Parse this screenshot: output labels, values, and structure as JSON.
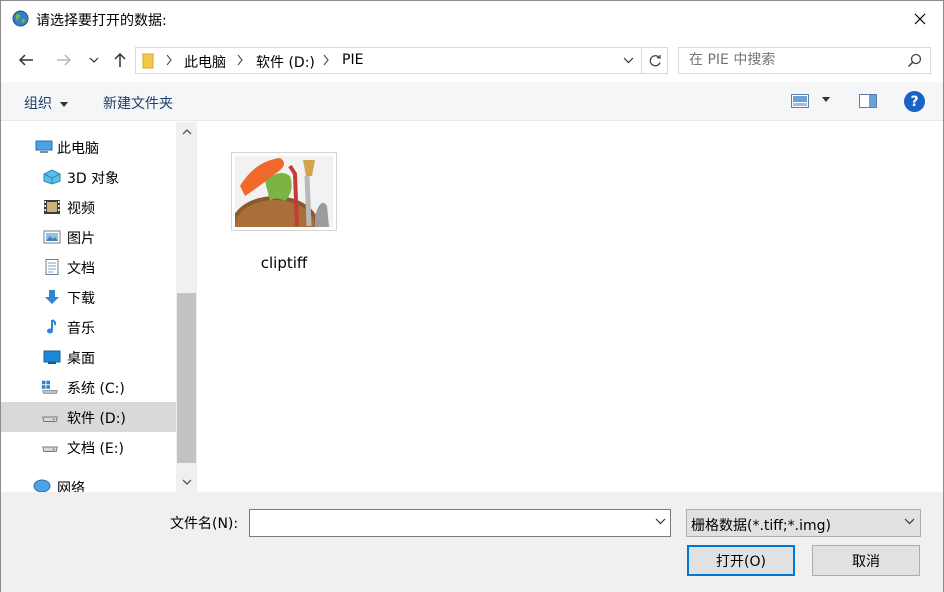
{
  "window": {
    "title": "请选择要打开的数据:"
  },
  "address": {
    "crumbs": [
      "此电脑",
      "软件 (D:)",
      "PIE"
    ]
  },
  "search": {
    "placeholder": "在 PIE 中搜索"
  },
  "toolbar": {
    "organize_label": "组织",
    "new_folder_label": "新建文件夹",
    "help_label": "?"
  },
  "navpane": {
    "items": [
      {
        "label": "此电脑",
        "icon": "computer-icon"
      },
      {
        "label": "3D 对象",
        "icon": "3d-objects-icon"
      },
      {
        "label": "视频",
        "icon": "video-icon"
      },
      {
        "label": "图片",
        "icon": "pictures-icon"
      },
      {
        "label": "文档",
        "icon": "documents-icon"
      },
      {
        "label": "下载",
        "icon": "download-icon"
      },
      {
        "label": "音乐",
        "icon": "music-icon"
      },
      {
        "label": "桌面",
        "icon": "desktop-icon"
      },
      {
        "label": "系统 (C:)",
        "icon": "windows-drive-icon"
      },
      {
        "label": "软件 (D:)",
        "icon": "drive-icon",
        "selected": true
      },
      {
        "label": "文档 (E:)",
        "icon": "drive-icon"
      },
      {
        "label": "网络",
        "icon": "network-icon"
      }
    ]
  },
  "files": [
    {
      "name": "cliptiff",
      "icon": "paint-palette-thumbnail"
    }
  ],
  "bottom": {
    "filename_label": "文件名(N):",
    "filename_value": "",
    "filetype_value": "栅格数据(*.tiff;*.img)",
    "open_label": "打开(O)",
    "cancel_label": "取消"
  },
  "colors": {
    "accent": "#0078d7",
    "selected_bg": "#d9d9d9",
    "help_blue": "#1764c4"
  }
}
